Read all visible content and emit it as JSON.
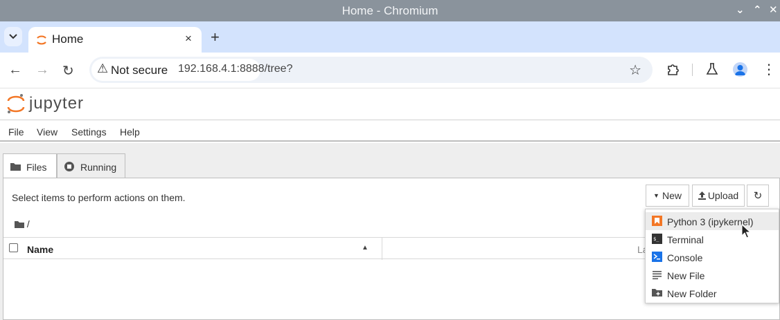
{
  "window": {
    "title": "Home - Chromium"
  },
  "browser": {
    "tab": {
      "title": "Home",
      "close_glyph": "×"
    },
    "new_tab_glyph": "+",
    "security_label": "Not secure",
    "url": "192.168.4.1:8888/tree?"
  },
  "jupyter": {
    "logo_text": "jupyter",
    "menu": [
      "File",
      "View",
      "Settings",
      "Help"
    ],
    "tabs": [
      {
        "label": "Files",
        "icon": "folder-icon",
        "active": true
      },
      {
        "label": "Running",
        "icon": "stop-circle-icon",
        "active": false
      }
    ],
    "hint": "Select items to perform actions on them.",
    "breadcrumb": "/",
    "toolbar": {
      "new_label": "New",
      "upload_label": "Upload"
    },
    "list": {
      "name_header": "Name",
      "last_modified_header": "La"
    },
    "new_menu": [
      {
        "label": "Python 3 (ipykernel)",
        "icon": "python-kernel-icon",
        "hover": true
      },
      {
        "label": "Terminal",
        "icon": "terminal-icon",
        "hover": false
      },
      {
        "label": "Console",
        "icon": "console-icon",
        "hover": false
      },
      {
        "label": "New File",
        "icon": "text-file-icon",
        "hover": false
      },
      {
        "label": "New Folder",
        "icon": "new-folder-icon",
        "hover": false
      }
    ]
  },
  "colors": {
    "titlebar": "#8a939c",
    "tabstrip": "#d3e3fd",
    "jupyter_orange": "#f37726",
    "console_blue": "#1a73e8"
  }
}
